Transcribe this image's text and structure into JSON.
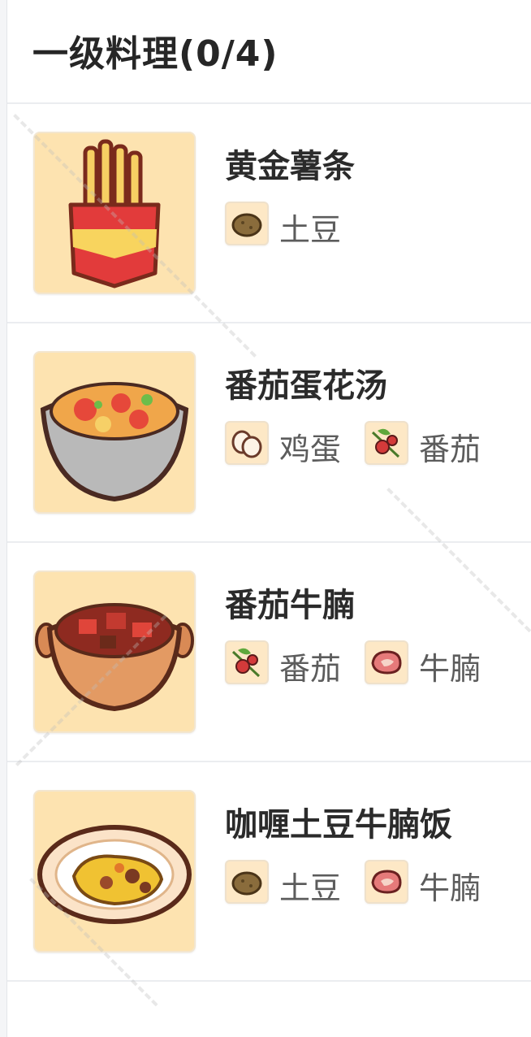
{
  "header": {
    "title": "一级料理(0/4)"
  },
  "dishes": [
    {
      "name": "黄金薯条",
      "image_icon": "golden-fries-icon",
      "ingredients": [
        {
          "label": "土豆",
          "icon": "potato-icon"
        }
      ]
    },
    {
      "name": "番茄蛋花汤",
      "image_icon": "tomato-egg-soup-icon",
      "ingredients": [
        {
          "label": "鸡蛋",
          "icon": "egg-icon"
        },
        {
          "label": "番茄",
          "icon": "tomato-icon"
        }
      ]
    },
    {
      "name": "番茄牛腩",
      "image_icon": "tomato-beef-brisket-icon",
      "ingredients": [
        {
          "label": "番茄",
          "icon": "tomato-icon"
        },
        {
          "label": "牛腩",
          "icon": "beef-brisket-icon"
        }
      ]
    },
    {
      "name": "咖喱土豆牛腩饭",
      "image_icon": "curry-beef-rice-icon",
      "ingredients": [
        {
          "label": "土豆",
          "icon": "potato-icon"
        },
        {
          "label": "牛腩",
          "icon": "beef-brisket-icon"
        }
      ]
    }
  ],
  "colors": {
    "card_background": "#ffffff",
    "thumbnail_background": "#fde3b0",
    "ingredient_tile_background": "#fde8c6",
    "divider": "#ebedf0",
    "title_text": "#262626",
    "ingredient_text": "#5c5c5c"
  }
}
